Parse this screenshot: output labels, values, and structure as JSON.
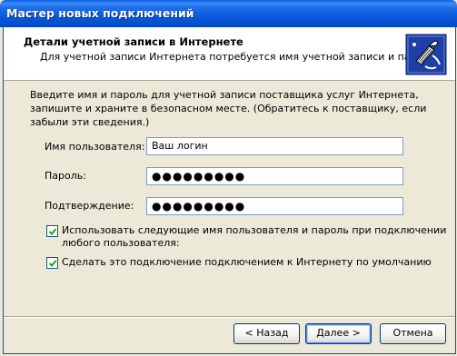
{
  "window": {
    "title": "Мастер новых подключений"
  },
  "header": {
    "title": "Детали учетной записи в Интернете",
    "subtitle": "Для учетной записи Интернета потребуется имя учетной записи и пароль.",
    "icon": "phone-connection-icon"
  },
  "intro": {
    "text": "Введите имя и пароль для учетной записи поставщика услуг Интернета, запишите и храните в безопасном месте. (Обратитесь к поставщику, если забыли эти сведения.)"
  },
  "form": {
    "username_label": "Имя пользователя:",
    "username_value": "Ваш логин",
    "password_label": "Пароль:",
    "password_value": "●●●●●●●●●",
    "confirm_label": "Подтверждение:",
    "confirm_value": "●●●●●●●●●"
  },
  "options": {
    "use_for_all_line1": "Использовать следующие имя пользователя и пароль при подключении",
    "use_for_all_line2": "любого пользователя:",
    "use_for_all_checked": true,
    "default_connection": "Сделать это подключение подключением к Интернету по умолчанию",
    "default_connection_checked": true
  },
  "buttons": {
    "back": "< Назад",
    "next": "Далее >",
    "cancel": "Отмена"
  },
  "colors": {
    "titlebar": "#0655d8",
    "window_bg": "#ece9d8",
    "field_border": "#7f9db9",
    "check_mark": "#21a121"
  }
}
